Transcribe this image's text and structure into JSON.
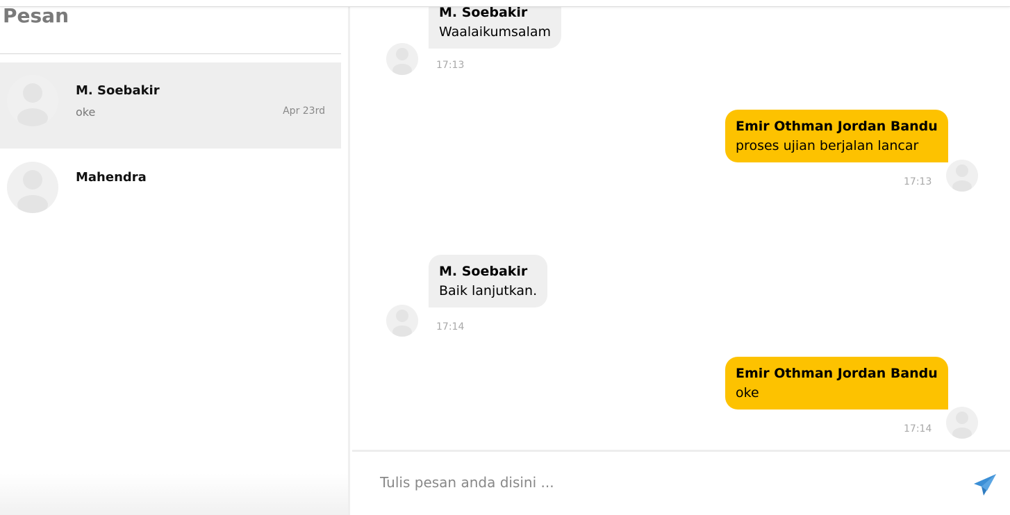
{
  "sidebar": {
    "title": "Pesan",
    "conversations": [
      {
        "name": "M. Soebakir",
        "last_message": "oke",
        "date": "Apr 23rd",
        "active": true
      },
      {
        "name": "Mahendra",
        "last_message": "",
        "date": "",
        "active": false
      }
    ]
  },
  "chat": {
    "messages": [
      {
        "direction": "in",
        "sender": "M. Soebakir",
        "text": "Waalaikumsalam",
        "time": "17:13"
      },
      {
        "direction": "out",
        "sender": "Emir Othman Jordan Bandu",
        "text": "proses ujian berjalan lancar",
        "time": "17:13"
      },
      {
        "direction": "in",
        "sender": "M. Soebakir",
        "text": "Baik lanjutkan.",
        "time": "17:14"
      },
      {
        "direction": "out",
        "sender": "Emir Othman Jordan Bandu",
        "text": "oke",
        "time": "17:14"
      }
    ]
  },
  "composer": {
    "placeholder": "Tulis pesan anda disini ..."
  },
  "icons": {
    "send": "send-paper-plane-icon",
    "avatar": "user-placeholder-icon"
  },
  "colors": {
    "outgoing_bubble": "#fdc200",
    "incoming_bubble": "#efefef",
    "active_conversation": "#eeeeee",
    "send_icon": "#3b8fd6"
  }
}
